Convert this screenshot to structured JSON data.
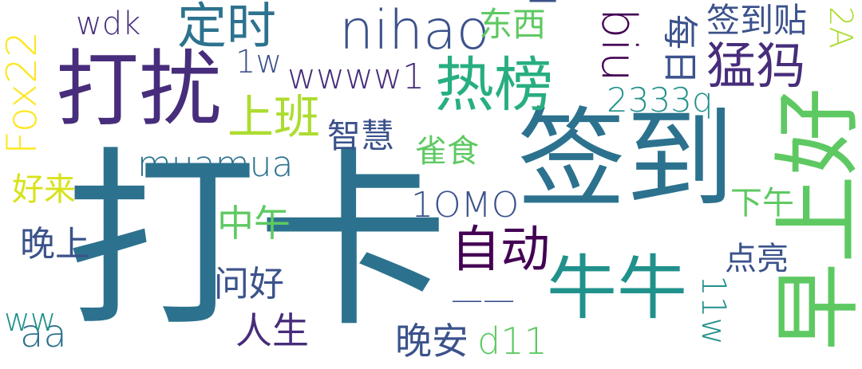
{
  "words": [
    {
      "text": "打卡",
      "color": "#2c728e"
    },
    {
      "text": "签到",
      "color": "#2c728e"
    },
    {
      "text": "早上好",
      "color": "#5ec962"
    },
    {
      "text": "打扰",
      "color": "#472d7b"
    },
    {
      "text": "牛牛",
      "color": "#21918c"
    },
    {
      "text": "热榜",
      "color": "#28ae80"
    },
    {
      "text": "nihao",
      "color": "#3b528b"
    },
    {
      "text": "Fox22",
      "color": "#fde725"
    },
    {
      "text": "biu",
      "color": "#440154"
    },
    {
      "text": "定时",
      "color": "#2c728e"
    },
    {
      "text": "猛犸",
      "color": "#472d7b"
    },
    {
      "text": "自动",
      "color": "#440154"
    },
    {
      "text": "上班",
      "color": "#addc30"
    },
    {
      "text": "wwww1",
      "color": "#472d7b"
    },
    {
      "text": "muamua",
      "color": "#2c728e"
    },
    {
      "text": "1OMO",
      "color": "#3b528b"
    },
    {
      "text": "2333q",
      "color": "#21918c"
    },
    {
      "text": "中午",
      "color": "#5ec962"
    },
    {
      "text": "每日",
      "color": "#3b528b"
    },
    {
      "text": "签到贴",
      "color": "#3b528b"
    },
    {
      "text": "晚安",
      "color": "#3b528b"
    },
    {
      "text": "d11",
      "color": "#5ec962"
    },
    {
      "text": "人生",
      "color": "#472d7b"
    },
    {
      "text": "晚上",
      "color": "#3b528b"
    },
    {
      "text": "问好",
      "color": "#3b528b"
    },
    {
      "text": "11w",
      "color": "#21918c"
    },
    {
      "text": "aa",
      "color": "#2c728e"
    },
    {
      "text": "——",
      "color": "#3b528b"
    },
    {
      "text": "东西",
      "color": "#5ec962"
    },
    {
      "text": "wdk",
      "color": "#472d7b"
    },
    {
      "text": "1w",
      "color": "#3b528b"
    },
    {
      "text": "智慧",
      "color": "#3b528b"
    },
    {
      "text": "雀食",
      "color": "#5ec962"
    },
    {
      "text": "好来",
      "color": "#d8e219"
    },
    {
      "text": "下午",
      "color": "#5ec962"
    },
    {
      "text": "点亮",
      "color": "#3b528b"
    },
    {
      "text": "ww",
      "color": "#21918c"
    },
    {
      "text": "2A",
      "color": "#addc30"
    },
    {
      "text": "一",
      "color": "#3b528b"
    }
  ]
}
